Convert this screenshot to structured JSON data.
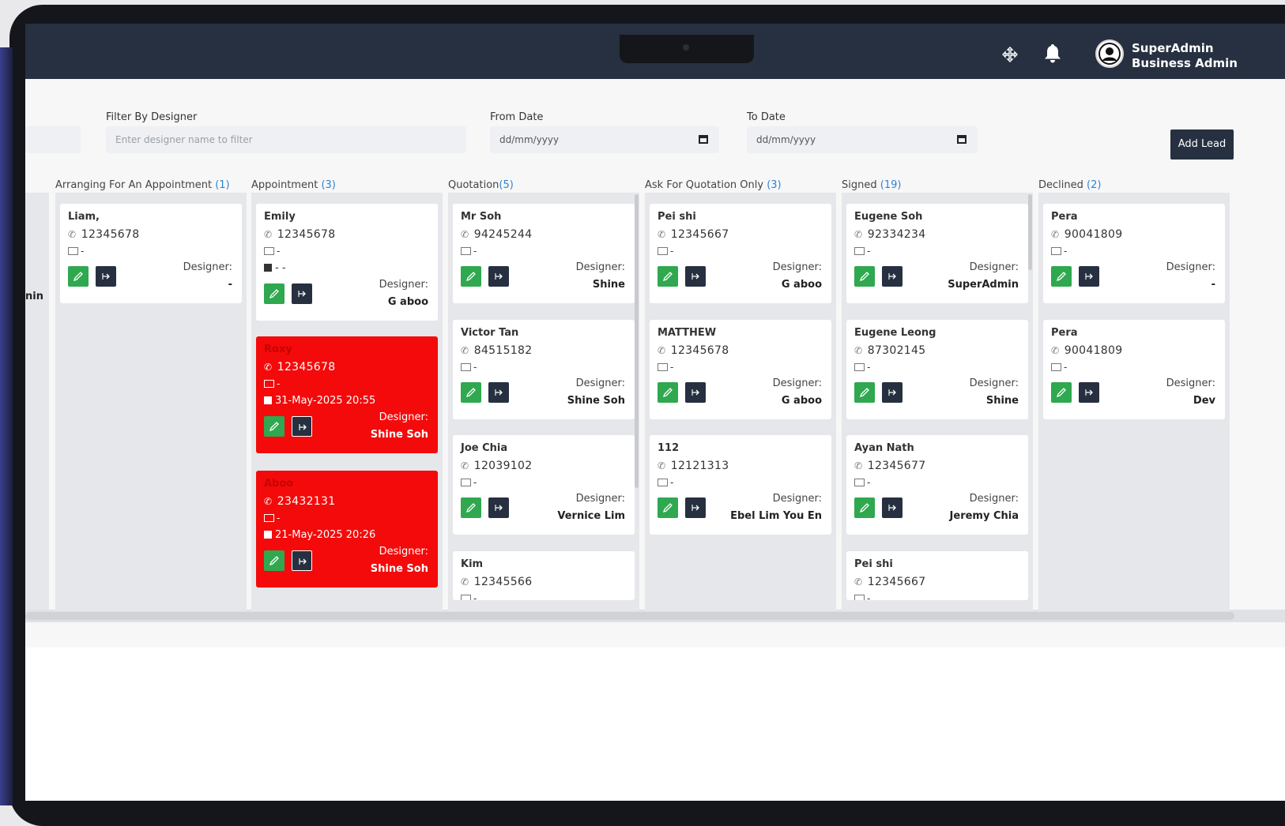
{
  "header": {
    "user_name": "SuperAdmin",
    "user_role": "Business Admin"
  },
  "filters": {
    "designer_label": "Filter By Designer",
    "designer_placeholder": "Enter designer name to filter",
    "from_label": "From Date",
    "from_value": "dd/mm/yyyy",
    "to_label": "To Date",
    "to_value": "dd/mm/yyyy",
    "add_lead": "Add Lead"
  },
  "partial_col_text": "nin",
  "columns": [
    {
      "title": "Arranging For An Appointment ",
      "count": "(1)",
      "cards": [
        {
          "name": "Liam,",
          "phone": "12345678",
          "email": "-",
          "designer_label": "Designer:",
          "designer": "-"
        }
      ]
    },
    {
      "title": "Appointment ",
      "count": "(3)",
      "cards": [
        {
          "name": "Emily",
          "phone": "12345678",
          "email": "-",
          "date": "- -",
          "designer_label": "Designer:",
          "designer": "G aboo"
        },
        {
          "name": "Roxy",
          "phone": "12345678",
          "email": "-",
          "date": "31-May-2025 20:55",
          "designer_label": "Designer:",
          "designer": "Shine Soh",
          "highlight": true
        },
        {
          "name": "Aboo",
          "phone": "23432131",
          "email": "-",
          "date": "21-May-2025 20:26",
          "designer_label": "Designer:",
          "designer": "Shine Soh",
          "highlight": true
        }
      ]
    },
    {
      "title": "Quotation",
      "count": "(5)",
      "cards": [
        {
          "name": "Mr Soh",
          "phone": "94245244",
          "email": "-",
          "designer_label": "Designer:",
          "designer": "Shine"
        },
        {
          "name": "Victor Tan",
          "phone": "84515182",
          "email": "-",
          "designer_label": "Designer:",
          "designer": "Shine Soh"
        },
        {
          "name": "Joe Chia",
          "phone": "12039102",
          "email": "-",
          "designer_label": "Designer:",
          "designer": "Vernice Lim"
        },
        {
          "name": "Kim",
          "phone": "12345566",
          "email": "-"
        }
      ]
    },
    {
      "title": "Ask For Quotation Only ",
      "count": "(3)",
      "cards": [
        {
          "name": "Pei shi",
          "phone": "12345667",
          "email": "-",
          "designer_label": "Designer:",
          "designer": "G aboo"
        },
        {
          "name": "MATTHEW",
          "phone": "12345678",
          "email": "-",
          "designer_label": "Designer:",
          "designer": "G aboo"
        },
        {
          "name": "112",
          "phone": "12121313",
          "email": "-",
          "designer_label": "Designer:",
          "designer": "Ebel Lim You En"
        }
      ]
    },
    {
      "title": "Signed ",
      "count": "(19)",
      "cards": [
        {
          "name": "Eugene Soh",
          "phone": "92334234",
          "email": "-",
          "designer_label": "Designer:",
          "designer": "SuperAdmin"
        },
        {
          "name": "Eugene Leong",
          "phone": "87302145",
          "email": "-",
          "designer_label": "Designer:",
          "designer": "Shine"
        },
        {
          "name": "Ayan Nath",
          "phone": "12345677",
          "email": "-",
          "designer_label": "Designer:",
          "designer": "Jeremy Chia"
        },
        {
          "name": "Pei shi",
          "phone": "12345667",
          "email": "-"
        }
      ]
    },
    {
      "title": "Declined ",
      "count": "(2)",
      "cards": [
        {
          "name": "Pera",
          "phone": "90041809",
          "email": "-",
          "designer_label": "Designer:",
          "designer": "-"
        },
        {
          "name": "Pera",
          "phone": "90041809",
          "email": "-",
          "designer_label": "Designer:",
          "designer": "Dev"
        }
      ]
    }
  ]
}
